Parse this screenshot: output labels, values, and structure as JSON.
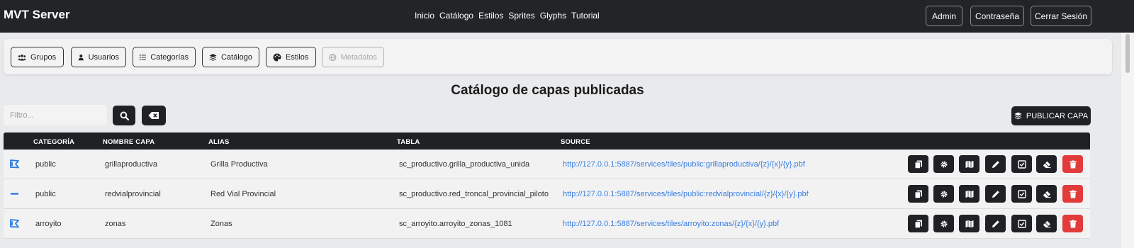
{
  "app": {
    "brand": "MVT Server"
  },
  "nav": {
    "links": [
      "Inicio",
      "Catálogo",
      "Estilos",
      "Sprites",
      "Glyphs",
      "Tutorial"
    ],
    "admin": "Admin",
    "password": "Contraseña",
    "logout": "Cerrar Sesión"
  },
  "toolbar": {
    "groups": "Grupos",
    "users": "Usuarios",
    "categories": "Categorías",
    "catalog": "Catálogo",
    "styles": "Estilos",
    "metadata": "Metadatos"
  },
  "page": {
    "title": "Catálogo de capas publicadas"
  },
  "filter": {
    "placeholder": "Filtro..."
  },
  "publish": {
    "label": "PUBLICAR CAPA"
  },
  "table": {
    "headers": {
      "category": "CATEGORÍA",
      "name": "NOMBRE CAPA",
      "alias": "ALIAS",
      "table": "TABLA",
      "source": "SOURCE"
    },
    "rows": [
      {
        "icon": "polygon-icon",
        "category": "public",
        "name": "grillaproductiva",
        "alias": "Grilla Productiva",
        "table": "sc_productivo.grilla_productiva_unida",
        "source": "http://127.0.0.1:5887/services/tiles/public:grillaproductiva/{z}/{x}/{y}.pbf"
      },
      {
        "icon": "line-icon",
        "category": "public",
        "name": "redvialprovincial",
        "alias": "Red Vial Provincial",
        "table": "sc_productivo.red_troncal_provincial_piloto",
        "source": "http://127.0.0.1:5887/services/tiles/public:redvialprovincial/{z}/{x}/{y}.pbf"
      },
      {
        "icon": "polygon-icon",
        "category": "arroyito",
        "name": "zonas",
        "alias": "Zonas",
        "table": "sc_arroyito.arroyito_zonas_1081",
        "source": "http://127.0.0.1:5887/services/tiles/arroyito:zonas/{z}/{x}/{y}.pbf"
      }
    ]
  },
  "colors": {
    "navbar": "#222427",
    "link": "#3b7fe0",
    "danger": "#e23b3b",
    "icon_blue": "#2a7ae2"
  }
}
